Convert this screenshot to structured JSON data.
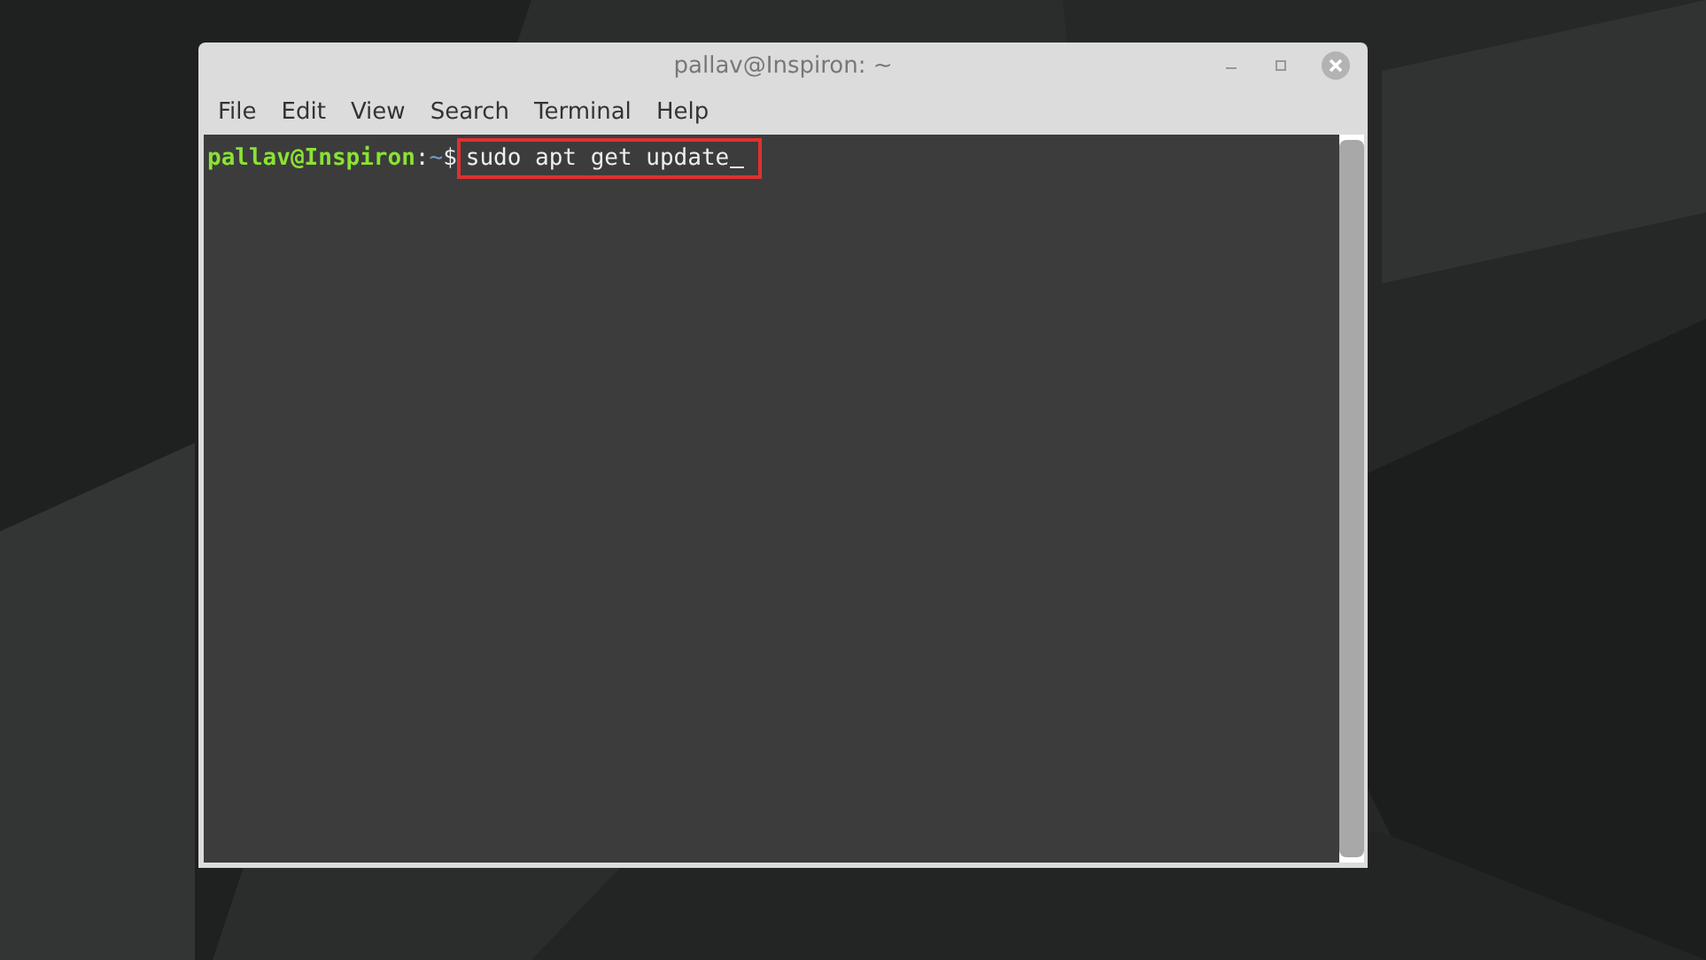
{
  "window": {
    "title": "pallav@Inspiron: ~"
  },
  "menu": [
    "File",
    "Edit",
    "View",
    "Search",
    "Terminal",
    "Help"
  ],
  "terminal": {
    "prompt": {
      "user_host": "pallav@Inspiron",
      "separator": ":",
      "path": "~",
      "symbol": "$"
    },
    "command": "sudo apt get update",
    "highlighted": true
  }
}
